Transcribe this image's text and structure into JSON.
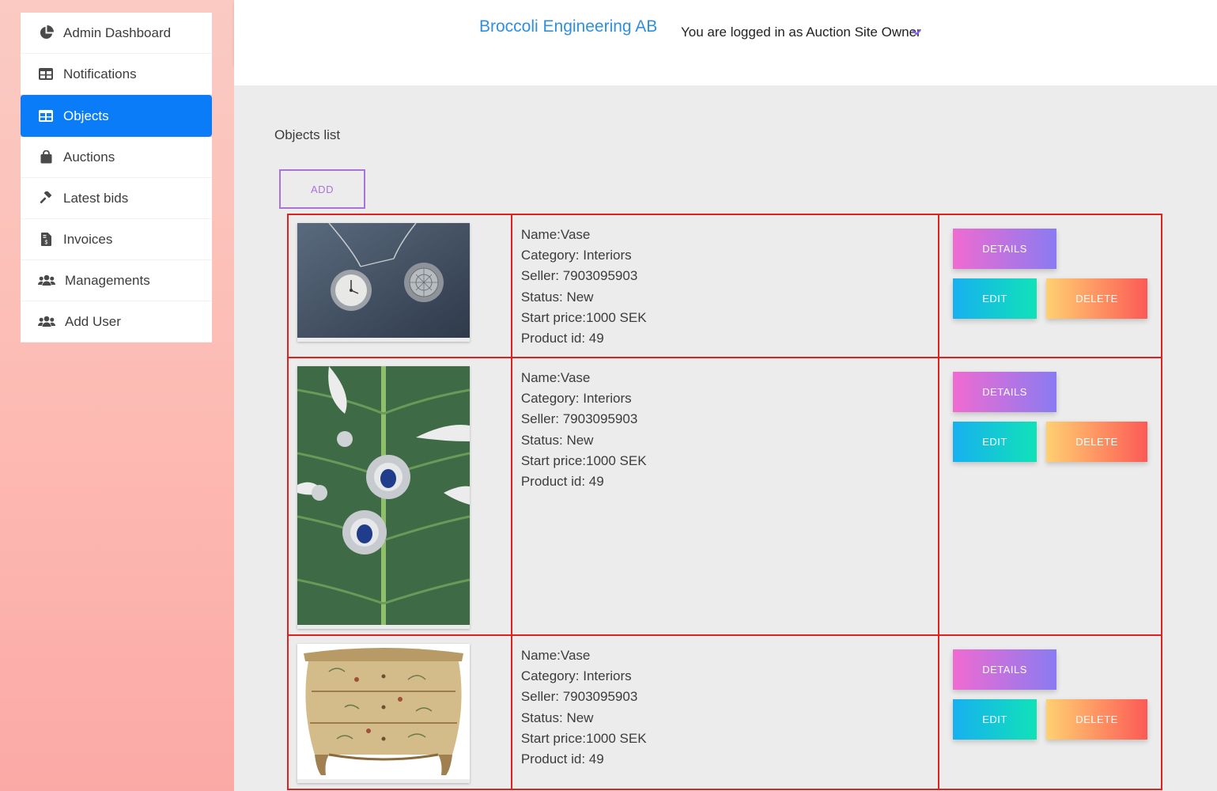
{
  "header": {
    "brand": "Broccoli Engineering AB",
    "login_info": "You are logged in as Auction Site Owner"
  },
  "sidebar": {
    "items": [
      {
        "label": "Admin Dashboard",
        "icon": "pie-chart-icon"
      },
      {
        "label": "Notifications",
        "icon": "table-icon"
      },
      {
        "label": "Objects",
        "icon": "table-icon",
        "active": true
      },
      {
        "label": "Auctions",
        "icon": "shopping-bag-icon"
      },
      {
        "label": "Latest bids",
        "icon": "gavel-icon"
      },
      {
        "label": "Invoices",
        "icon": "invoice-icon"
      },
      {
        "label": "Managements",
        "icon": "users-icon"
      },
      {
        "label": "Add User",
        "icon": "users-icon"
      }
    ]
  },
  "main": {
    "title": "Objects list",
    "add_label": "ADD",
    "actions": {
      "details": "DETAILS",
      "edit": "EDIT",
      "delete": "DELETE"
    },
    "rows": [
      {
        "image": "pocket-watches-photo",
        "name": "Name:Vase",
        "category": "Category: Interiors",
        "seller": "Seller: 7903095903",
        "status": "Status: New",
        "start_price": "Start price:1000 SEK",
        "product_id": "Product id: 49"
      },
      {
        "image": "earrings-on-leaf-photo",
        "name": "Name:Vase",
        "category": "Category: Interiors",
        "seller": "Seller: 7903095903",
        "status": "Status: New",
        "start_price": "Start price:1000 SEK",
        "product_id": "Product id: 49"
      },
      {
        "image": "painted-dresser-photo",
        "name": "Name:Vase",
        "category": "Category: Interiors",
        "seller": "Seller: 7903095903",
        "status": "Status: New",
        "start_price": "Start price:1000 SEK",
        "product_id": "Product id: 49"
      }
    ]
  },
  "colors": {
    "accent_blue": "#0a7cf8",
    "brand_blue": "#2f8fe0",
    "table_border": "#e12020",
    "add_purple": "#a973d9"
  }
}
